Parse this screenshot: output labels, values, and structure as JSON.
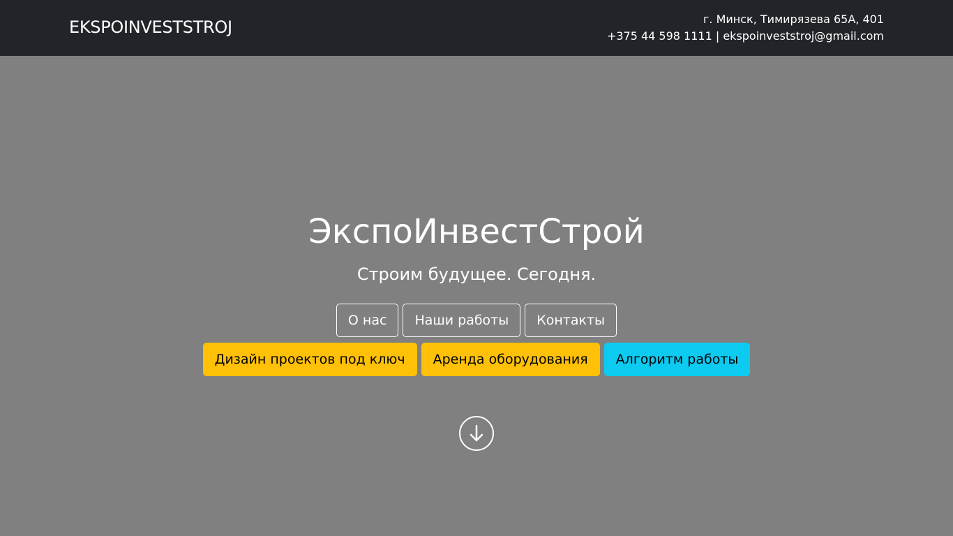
{
  "header": {
    "brand": "EKSPOINVESTSTROJ",
    "address": "г. Минск, Тимирязева 65А, 401",
    "phone": "+375 44 598 1111",
    "separator": " | ",
    "email": "ekspoinveststroj@gmail.com"
  },
  "hero": {
    "title": "ЭкспоИнвестСтрой",
    "subtitle": "Строим будущее. Сегодня.",
    "nav_buttons": [
      {
        "label": "О нас"
      },
      {
        "label": "Наши работы"
      },
      {
        "label": "Контакты"
      }
    ],
    "action_buttons": [
      {
        "label": "Дизайн проектов под ключ",
        "color": "#ffc107"
      },
      {
        "label": "Аренда оборудования",
        "color": "#ffc107"
      },
      {
        "label": "Алгоритм работы",
        "color": "#0dcaf0"
      }
    ],
    "scroll_icon": "arrow-down-circle-icon"
  },
  "colors": {
    "header_bg": "#212529",
    "hero_bg": "#808080",
    "warning": "#ffc107",
    "info": "#0dcaf0"
  }
}
